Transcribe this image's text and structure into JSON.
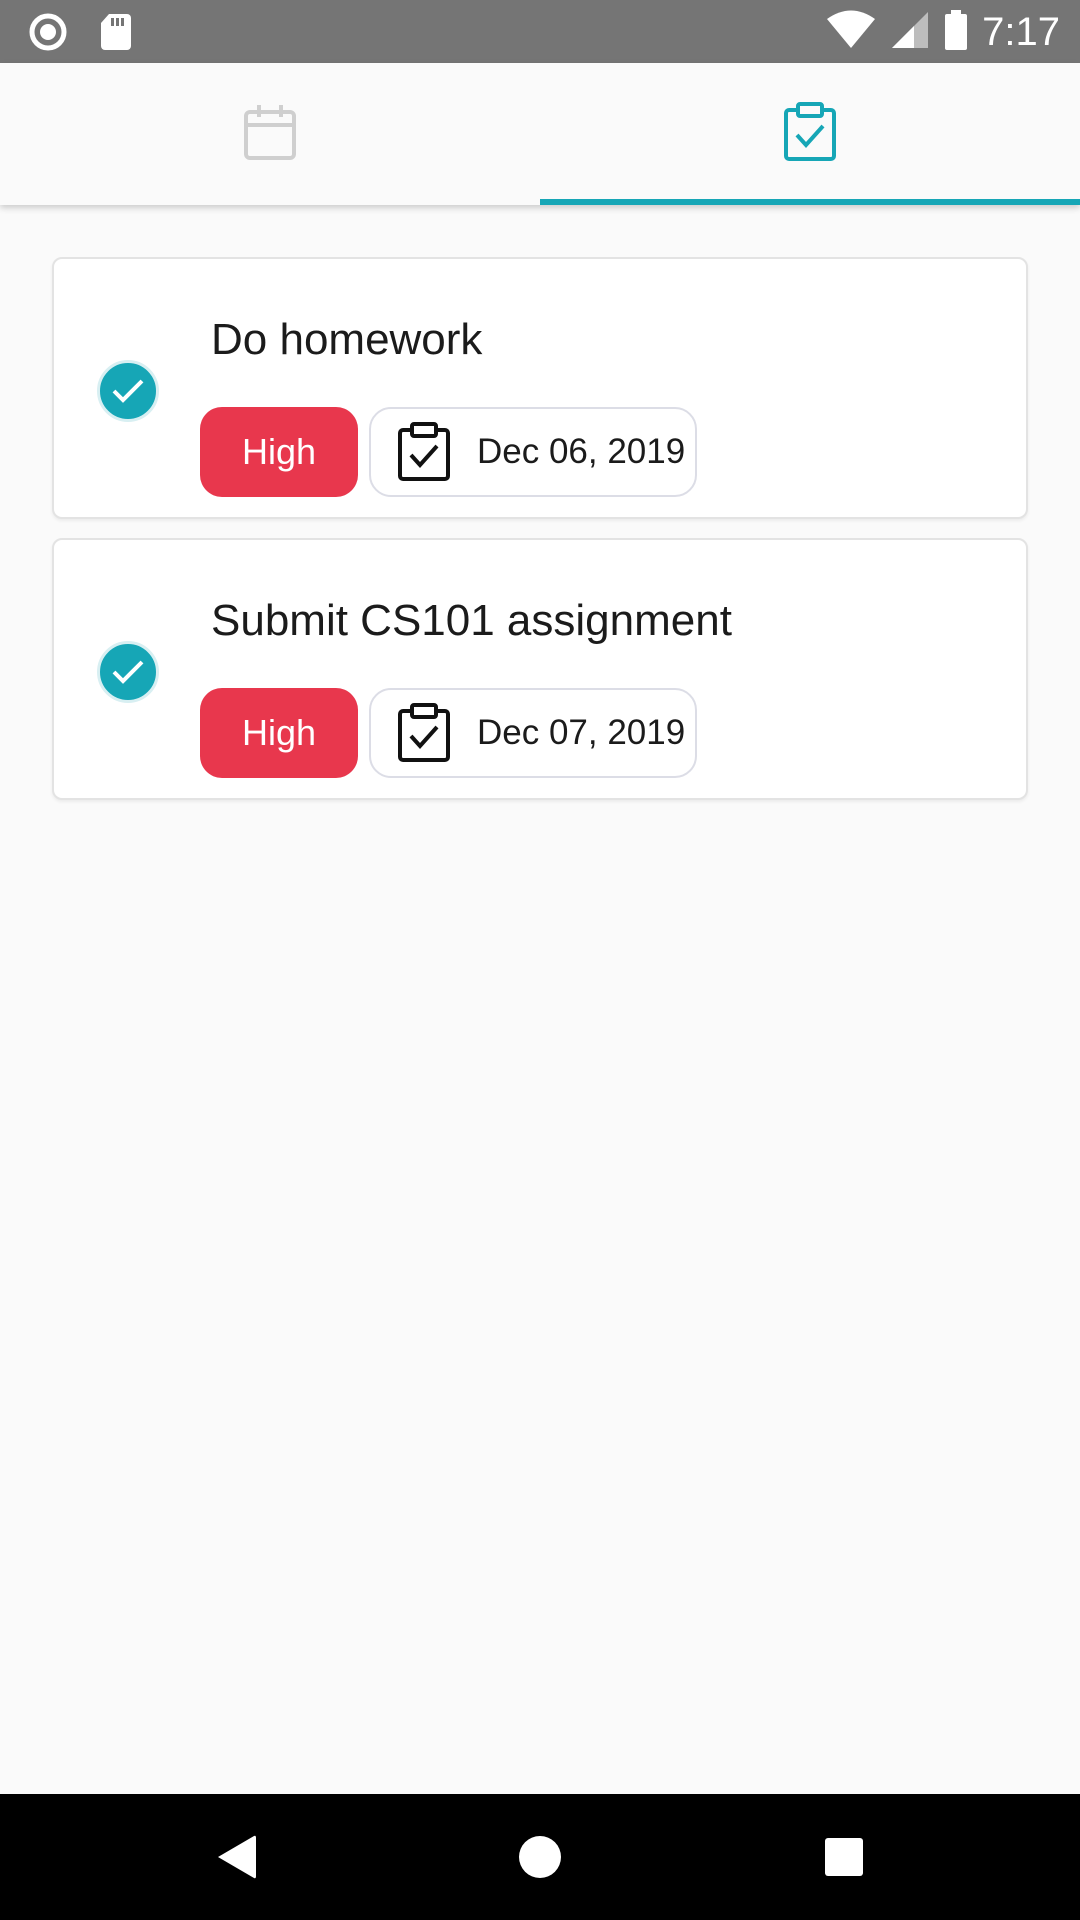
{
  "status_bar": {
    "time": "7:17",
    "icons": [
      "record-icon",
      "sd-card-icon",
      "wifi-icon",
      "signal-icon",
      "battery-icon"
    ]
  },
  "tabs": [
    {
      "name": "calendar",
      "icon": "calendar-icon",
      "selected": false
    },
    {
      "name": "tasks",
      "icon": "clipboard-check-icon",
      "selected": true
    }
  ],
  "colors": {
    "accent": "#16a6b6",
    "priority_high": "#e8374d",
    "status_bar": "#757575",
    "background": "#fafafa"
  },
  "tasks": [
    {
      "title": "Do homework",
      "priority": "High",
      "date": "Dec 06, 2019",
      "completed": true
    },
    {
      "title": "Submit CS101 assignment",
      "priority": "High",
      "date": "Dec 07, 2019",
      "completed": true
    }
  ],
  "nav_bar": {
    "icons": [
      "back-icon",
      "home-icon",
      "recents-icon"
    ]
  }
}
